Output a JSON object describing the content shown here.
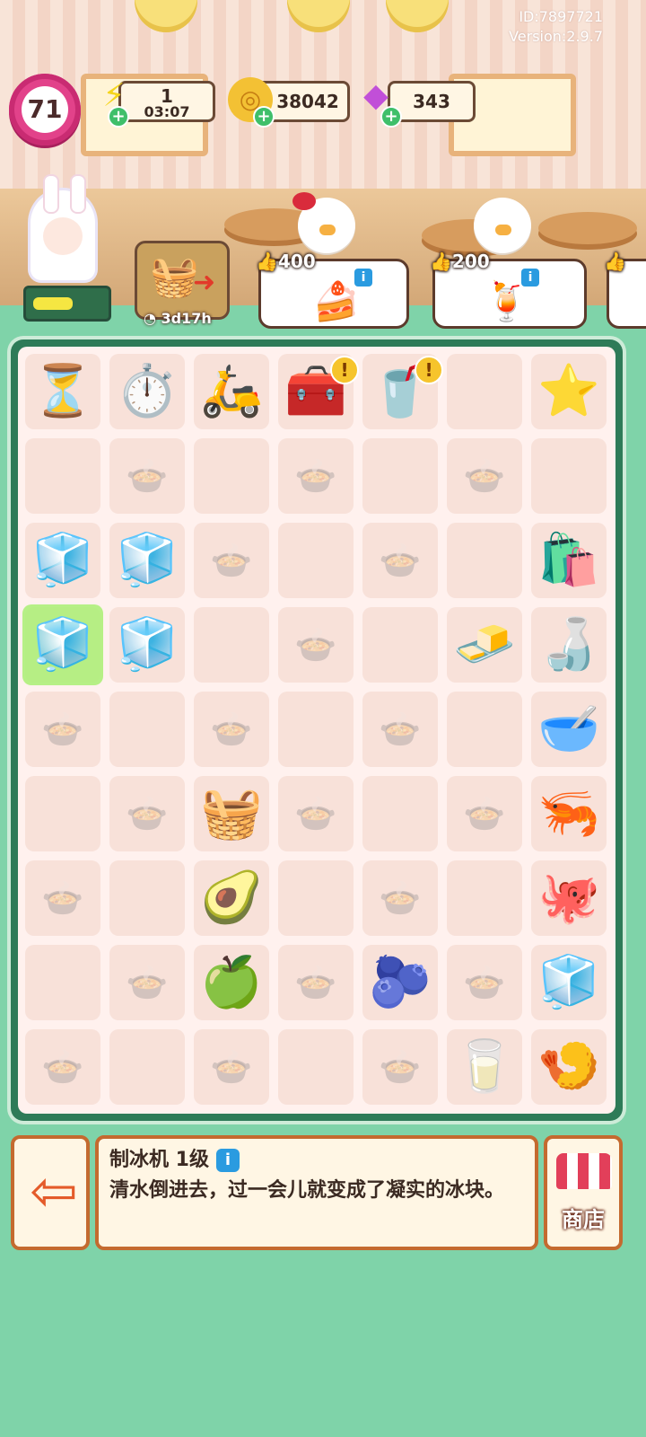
{
  "meta": {
    "id": "ID:7897721",
    "version": "Version:2.9.7"
  },
  "hud": {
    "level": "71",
    "energy": {
      "value": "1",
      "timer": "03:07"
    },
    "coins": "38042",
    "gems": "343"
  },
  "event": {
    "timer": "3d17h"
  },
  "orders": [
    {
      "reward": "400",
      "item_icon": "cake-icon"
    },
    {
      "reward": "200",
      "item_icon": "lime-drink-icon"
    }
  ],
  "board": {
    "pieces": [
      {
        "name": "hourglass",
        "emoji": "⏳"
      },
      {
        "name": "stopwatch",
        "emoji": "⏱️"
      },
      {
        "name": "delivery-scooter",
        "emoji": "🛵"
      },
      {
        "name": "grill-appliance",
        "emoji": "🧰"
      },
      {
        "name": "blender",
        "emoji": "🥤"
      },
      {
        "name": "star",
        "emoji": "⭐"
      },
      {
        "name": "ice-cubes",
        "emoji": "🧊"
      },
      {
        "name": "ice-cubes",
        "emoji": "🧊"
      },
      {
        "name": "flour-bag",
        "emoji": "🛍️"
      },
      {
        "name": "ice-machine",
        "emoji": "🧊"
      },
      {
        "name": "ice-cubes",
        "emoji": "🧊"
      },
      {
        "name": "butter",
        "emoji": "🧈"
      },
      {
        "name": "stand-mixer",
        "emoji": "🍶"
      },
      {
        "name": "dough-bowl",
        "emoji": "🥣"
      },
      {
        "name": "fruit-basket",
        "emoji": "🧺"
      },
      {
        "name": "shrimp",
        "emoji": "🦐"
      },
      {
        "name": "avocado",
        "emoji": "🥑"
      },
      {
        "name": "octopus",
        "emoji": "🐙"
      },
      {
        "name": "apple",
        "emoji": "🍏"
      },
      {
        "name": "blueberries",
        "emoji": "🫐"
      },
      {
        "name": "fridge",
        "emoji": "🧊"
      },
      {
        "name": "milk",
        "emoji": "🥛"
      },
      {
        "name": "prawn",
        "emoji": "🍤"
      }
    ]
  },
  "selected": {
    "title": "制冰机 1级",
    "description": "清水倒进去，过一会儿就变成了凝实的冰块。"
  },
  "shop_label": "商店"
}
